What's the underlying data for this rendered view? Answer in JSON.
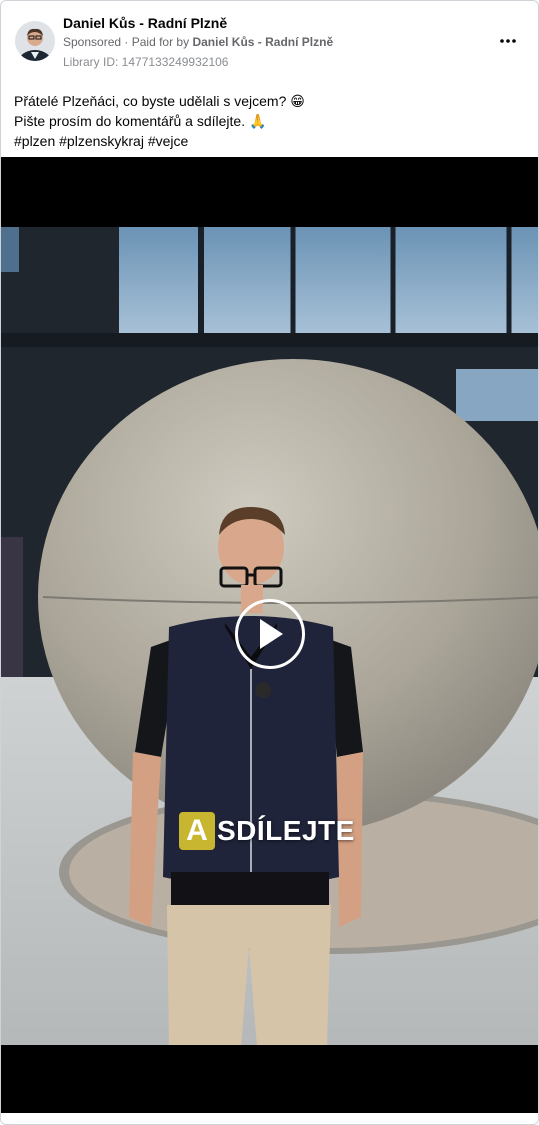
{
  "post": {
    "author": "Daniel Kůs - Radní Plzně",
    "sponsored": "Sponsored",
    "paid_for_by_prefix": "Paid for by",
    "paid_for_by": "Daniel Kůs - Radní Plzně",
    "library_id": "Library ID: 1477133249932106",
    "lines": [
      "Přátelé Plzeňáci, co byste udělali s vejcem? 😁",
      "Pište prosím do komentářů a sdílejte. 🙏",
      "#plzen #plzenskykraj #vejce"
    ]
  },
  "video": {
    "caption_letter": "A",
    "caption_rest": "SDÍLEJTE"
  },
  "icons": {
    "more": "more-horizontal-icon",
    "play": "play-icon"
  }
}
